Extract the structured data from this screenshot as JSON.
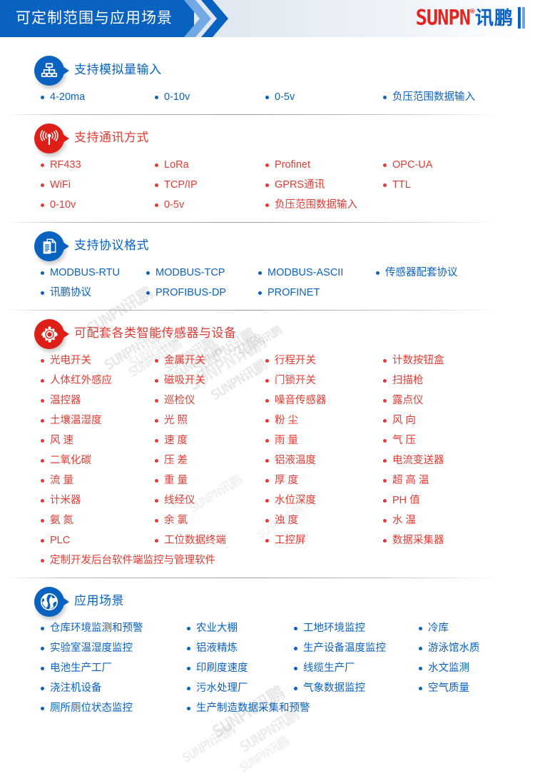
{
  "header": {
    "title": "可定制范围与应用场景",
    "logo_brand": "SUNPN",
    "logo_reg": "®",
    "logo_cn": "讯鹏"
  },
  "watermark_text": "SUNPN讯鹏",
  "colors": {
    "blue": "#0a62c0",
    "red": "#dd1f18",
    "red_text": "#e23b33",
    "header_block": "#0a62c0"
  },
  "sections": [
    {
      "id": "analog-input",
      "icon": "sitemap-icon",
      "color": "blue",
      "title": "支持模拟量输入",
      "items": [
        "4-20ma",
        "0-10v",
        "0-5v",
        "负压范围数据输入"
      ]
    },
    {
      "id": "communication",
      "icon": "broadcast-antenna-icon",
      "color": "red",
      "title": "支持通讯方式",
      "items": [
        "RF433",
        "LoRa",
        "Profinet",
        "OPC-UA",
        "WiFi",
        "TCP/IP",
        "GPRS通讯",
        "TTL",
        "0-10v",
        "0-5v",
        "负压范围数据输入"
      ]
    },
    {
      "id": "protocol",
      "icon": "documents-icon",
      "color": "blue",
      "title": "支持协议格式",
      "items": [
        "MODBUS-RTU",
        "MODBUS-TCP",
        "MODBUS-ASCII",
        "传感器配套协议",
        "讯鹏协议",
        "PROFIBUS-DP",
        "PROFINET"
      ]
    },
    {
      "id": "sensors",
      "icon": "gear-icon",
      "color": "red",
      "title": "可配套各类智能传感器与设备",
      "items": [
        "光电开关",
        "金属开关",
        "行程开关",
        "计数按钮盒",
        "人体红外感应",
        "磁吸开关",
        "门锁开关",
        "扫描枪",
        "温控器",
        "巡检仪",
        "噪音传感器",
        "露点仪",
        "土壤温湿度",
        "光 照",
        "粉 尘",
        "风 向",
        "风 速",
        "速 度",
        "雨 量",
        "气 压",
        "二氧化碳",
        "压 差",
        "铝液温度",
        "电流变送器",
        "流 量",
        "重 量",
        "厚 度",
        "超 高 温",
        "计米器",
        "线经仪",
        "水位深度",
        "PH 值",
        "氨 氮",
        "余 氯",
        "浊 度",
        "水 温",
        "PLC",
        "工位数据终端",
        "工控屏",
        "数据采集器",
        "定制开发后台软件端监控与管理软件"
      ]
    },
    {
      "id": "applications",
      "icon": "globe-icon",
      "color": "blue",
      "title": "应用场景",
      "items": [
        "仓库环境监测和预警",
        "农业大棚",
        "工地环境监控",
        "冷库",
        "实验室温湿度监控",
        "铝液精炼",
        "生产设备温度监控",
        "游泳馆水质",
        "电池生产工厂",
        "印刷度速度",
        "线缆生产厂",
        "水文监测",
        "浇注机设备",
        "污水处理厂",
        "气象数据监控",
        "空气质量",
        "厕所厕位状态监控",
        "生产制造数据采集和预警"
      ]
    }
  ]
}
